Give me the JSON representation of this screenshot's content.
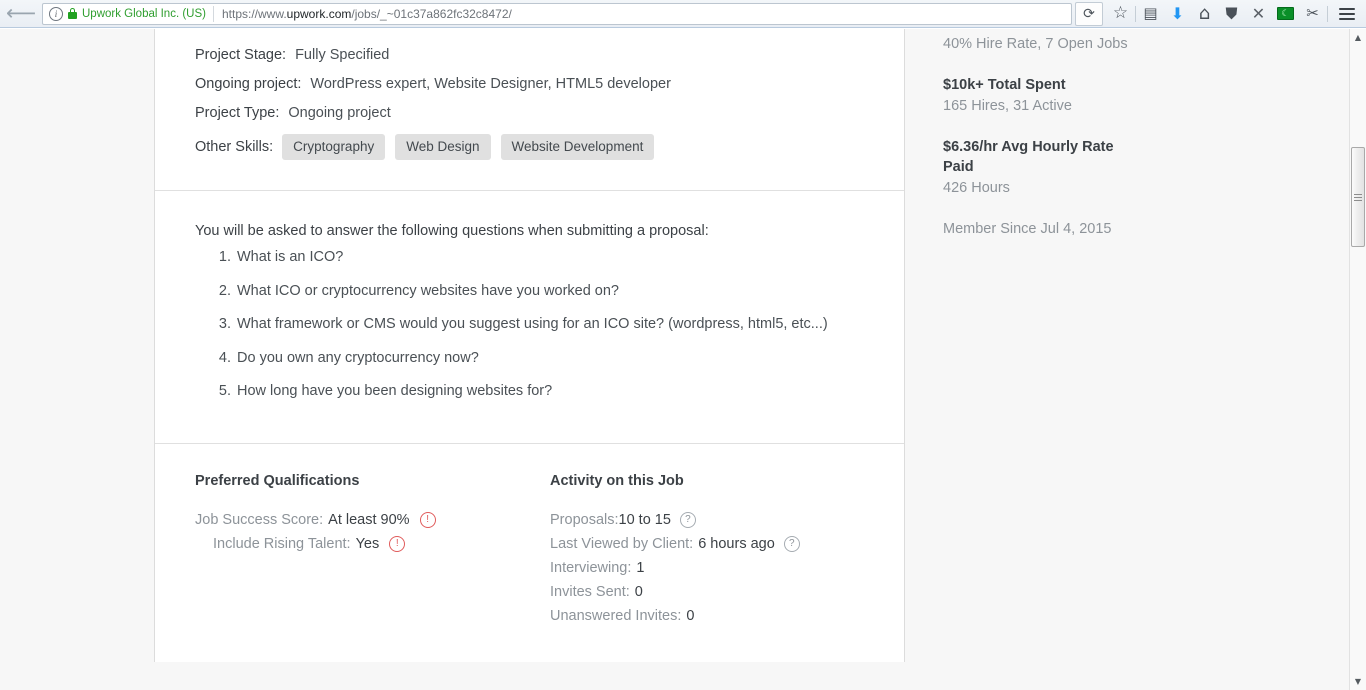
{
  "browser": {
    "back_button_label": "←",
    "identity": {
      "info_icon": "info-icon",
      "lock_icon": "lock-icon",
      "owner": "Upwork Global Inc. (US)"
    },
    "url": "https://www.upwork.com/jobs/_~01c37a862fc32c8472/",
    "url_prefix": "https://www.",
    "url_host": "upwork.com",
    "url_suffix": "/jobs/_~01c37a862fc32c8472/",
    "reload_label": "⟳",
    "toolbar_icons": [
      {
        "name": "bookmark-star-icon",
        "glyph": "☆"
      },
      {
        "name": "library-icon",
        "glyph": "▤"
      },
      {
        "name": "downloads-icon",
        "glyph": "⬇"
      },
      {
        "name": "home-icon",
        "glyph": "⌂"
      },
      {
        "name": "pocket-icon",
        "glyph": "⛊"
      },
      {
        "name": "x-extension-icon",
        "glyph": "✕"
      },
      {
        "name": "green-extension-icon",
        "glyph": "☾"
      },
      {
        "name": "scissors-extension-icon",
        "glyph": "✂"
      }
    ],
    "menu_label": "menu-icon",
    "scrollbar": {
      "up_arrow": "▲",
      "down_arrow": "▼"
    }
  },
  "job": {
    "details": [
      {
        "label": "Project Stage:",
        "value": "Fully Specified"
      },
      {
        "label": "Ongoing project:",
        "value": "WordPress expert, Website Designer, HTML5 developer"
      },
      {
        "label": "Project Type:",
        "value": "Ongoing project"
      }
    ],
    "skills_label": "Other Skills:",
    "skills": [
      "Cryptography",
      "Web Design",
      "Website Development"
    ],
    "questions_intro": "You will be asked to answer the following questions when submitting a proposal:",
    "questions": [
      "What is an ICO?",
      "What ICO or cryptocurrency websites have you worked on?",
      "What framework or CMS would you suggest using for an ICO site? (wordpress, html5, etc...)",
      "Do you own any cryptocurrency now?",
      "How long have you been designing websites for?"
    ],
    "qualifications": {
      "heading": "Preferred Qualifications",
      "items": [
        {
          "label": "Job Success Score:",
          "value": "At least 90%",
          "icon": "warning-icon",
          "icon_glyph": "!",
          "indent": false
        },
        {
          "label": "Include Rising Talent:",
          "value": "Yes",
          "icon": "warning-icon",
          "icon_glyph": "!",
          "indent": true
        }
      ]
    },
    "activity": {
      "heading": "Activity on this Job",
      "items": [
        {
          "label": "Proposals:",
          "value": "10 to 15",
          "icon": "help-icon",
          "icon_glyph": "?",
          "tight": true
        },
        {
          "label": "Last Viewed by Client:",
          "value": "6 hours ago",
          "icon": "help-icon",
          "icon_glyph": "?",
          "tight": false
        },
        {
          "label": "Interviewing:",
          "value": "1",
          "icon": null,
          "tight": false
        },
        {
          "label": "Invites Sent:",
          "value": "0",
          "icon": null,
          "tight": false
        },
        {
          "label": "Unanswered Invites:",
          "value": "0",
          "icon": null,
          "tight": false
        }
      ]
    }
  },
  "client_sidebar": {
    "hire_rate": "40% Hire Rate, 7 Open Jobs",
    "total_spent": "$10k+ Total Spent",
    "hires": "165 Hires, 31 Active",
    "avg_rate": "$6.36/hr Avg Hourly Rate Paid",
    "hours": "426 Hours",
    "member_since": "Member Since Jul 4, 2015"
  },
  "colors": {
    "skill_tag_bg": "#e0e0e0",
    "warning": "#e05c5c",
    "muted_text": "#8d9399",
    "body_text": "#3c4146",
    "lock_green": "#21a121",
    "page_bg": "#f7f7f7"
  }
}
